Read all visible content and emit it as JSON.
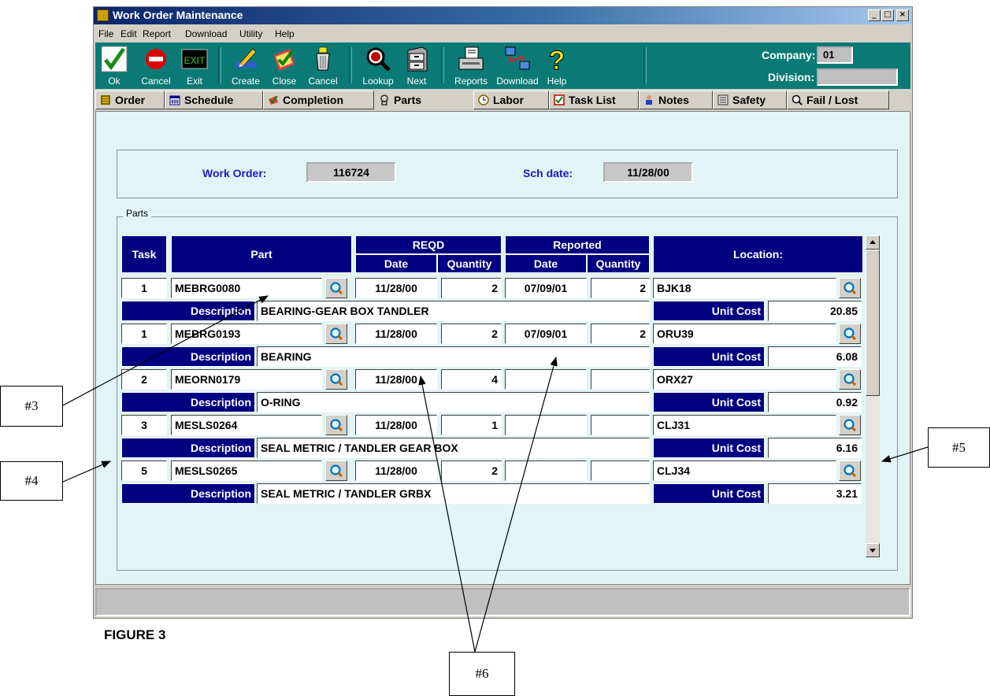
{
  "window": {
    "title": "Work Order Maintenance",
    "controls": [
      "_",
      "□",
      "×"
    ]
  },
  "menu": [
    "File",
    "Edit",
    "Report",
    "Download",
    "Utility",
    "Help"
  ],
  "toolbar": {
    "groups": [
      [
        {
          "label": "Ok",
          "icon": "checkmark-icon"
        },
        {
          "label": "Cancel",
          "icon": "no-entry-icon"
        },
        {
          "label": "Exit",
          "icon": "exit-sign-icon"
        }
      ],
      [
        {
          "label": "Create",
          "icon": "pencil-paper-icon"
        },
        {
          "label": "Close",
          "icon": "checklist-icon"
        },
        {
          "label": "Cancel",
          "icon": "trash-can-icon"
        }
      ],
      [
        {
          "label": "Lookup",
          "icon": "magnifier-icon"
        },
        {
          "label": "Next",
          "icon": "file-cabinet-icon"
        }
      ],
      [
        {
          "label": "Reports",
          "icon": "printer-icon"
        },
        {
          "label": "Download",
          "icon": "network-computers-icon"
        },
        {
          "label": "Help",
          "icon": "question-mark-icon"
        }
      ]
    ],
    "company_label": "Company:",
    "company_value": "01",
    "division_label": "Division:",
    "division_value": ""
  },
  "tabs": [
    {
      "label": "Order",
      "icon": "order-icon"
    },
    {
      "label": "Schedule",
      "icon": "calendar-icon"
    },
    {
      "label": "Completion",
      "icon": "completion-icon"
    },
    {
      "label": "Parts",
      "icon": "parts-icon",
      "active": true
    },
    {
      "label": "Labor",
      "icon": "clock-icon"
    },
    {
      "label": "Task List",
      "icon": "task-list-icon"
    },
    {
      "label": "Notes",
      "icon": "notes-icon"
    },
    {
      "label": "Safety",
      "icon": "safety-icon"
    },
    {
      "label": "Fail / Lost",
      "icon": "fail-lost-icon"
    }
  ],
  "header": {
    "work_order_label": "Work Order:",
    "work_order_value": "116724",
    "sch_date_label": "Sch date:",
    "sch_date_value": "11/28/00"
  },
  "parts": {
    "group_label": "Parts",
    "columns": {
      "task": "Task",
      "part": "Part",
      "reqd": "REQD",
      "reported": "Reported",
      "date": "Date",
      "quantity": "Quantity",
      "location": "Location:"
    },
    "description_label": "Description",
    "unit_cost_label": "Unit Cost",
    "rows": [
      {
        "task": "1",
        "part": "MEBRG0080",
        "reqd_date": "11/28/00",
        "reqd_qty": "2",
        "rep_date": "07/09/01",
        "rep_qty": "2",
        "location": "BJK18",
        "description": "BEARING-GEAR BOX TANDLER",
        "unit_cost": "20.85"
      },
      {
        "task": "1",
        "part": "MEBRG0193",
        "reqd_date": "11/28/00",
        "reqd_qty": "2",
        "rep_date": "07/09/01",
        "rep_qty": "2",
        "location": "ORU39",
        "description": "BEARING",
        "unit_cost": "6.08"
      },
      {
        "task": "2",
        "part": "MEORN0179",
        "reqd_date": "11/28/00",
        "reqd_qty": "4",
        "rep_date": "",
        "rep_qty": "",
        "location": "ORX27",
        "description": "O-RING",
        "unit_cost": "0.92"
      },
      {
        "task": "3",
        "part": "MESLS0264",
        "reqd_date": "11/28/00",
        "reqd_qty": "1",
        "rep_date": "",
        "rep_qty": "",
        "location": "CLJ31",
        "description": "SEAL METRIC / TANDLER GEAR BOX",
        "unit_cost": "6.16"
      },
      {
        "task": "5",
        "part": "MESLS0265",
        "reqd_date": "11/28/00",
        "reqd_qty": "2",
        "rep_date": "",
        "rep_qty": "",
        "location": "CLJ34",
        "description": "SEAL METRIC / TANDLER GRBX",
        "unit_cost": "3.21"
      }
    ]
  },
  "figure_label": "FIGURE 3",
  "callouts": [
    "#3",
    "#4",
    "#5",
    "#6"
  ],
  "colors": {
    "toolbar": "#0b7a76",
    "header": "#000080",
    "content": "#e2f4f5",
    "blue_label": "#1a1ac8"
  }
}
